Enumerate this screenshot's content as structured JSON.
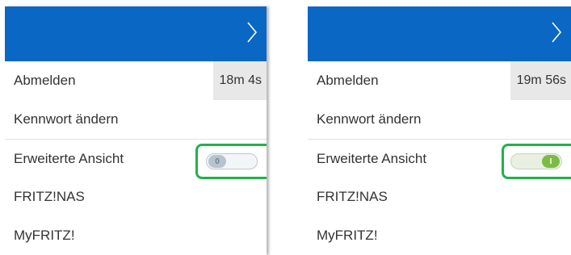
{
  "panels": [
    {
      "session_timer": "18m 4s",
      "menu": {
        "logout": "Abmelden",
        "change_password": "Kennwort ändern",
        "extended_view": "Erweiterte Ansicht",
        "nas": "FRITZ!NAS",
        "myfritz": "MyFRITZ!"
      },
      "toggle": {
        "state": "off",
        "label": "0"
      }
    },
    {
      "session_timer": "19m 56s",
      "menu": {
        "logout": "Abmelden",
        "change_password": "Kennwort ändern",
        "extended_view": "Erweiterte Ansicht",
        "nas": "FRITZ!NAS",
        "myfritz": "MyFRITZ!"
      },
      "toggle": {
        "state": "on",
        "label": "I"
      }
    }
  ],
  "colors": {
    "header_blue": "#0a67c4",
    "highlight_green": "#22b14c",
    "toggle_on": "#7cbc45",
    "toggle_off": "#b6c3d1"
  },
  "icons": {
    "header_chevron": "chevron-right-icon"
  }
}
